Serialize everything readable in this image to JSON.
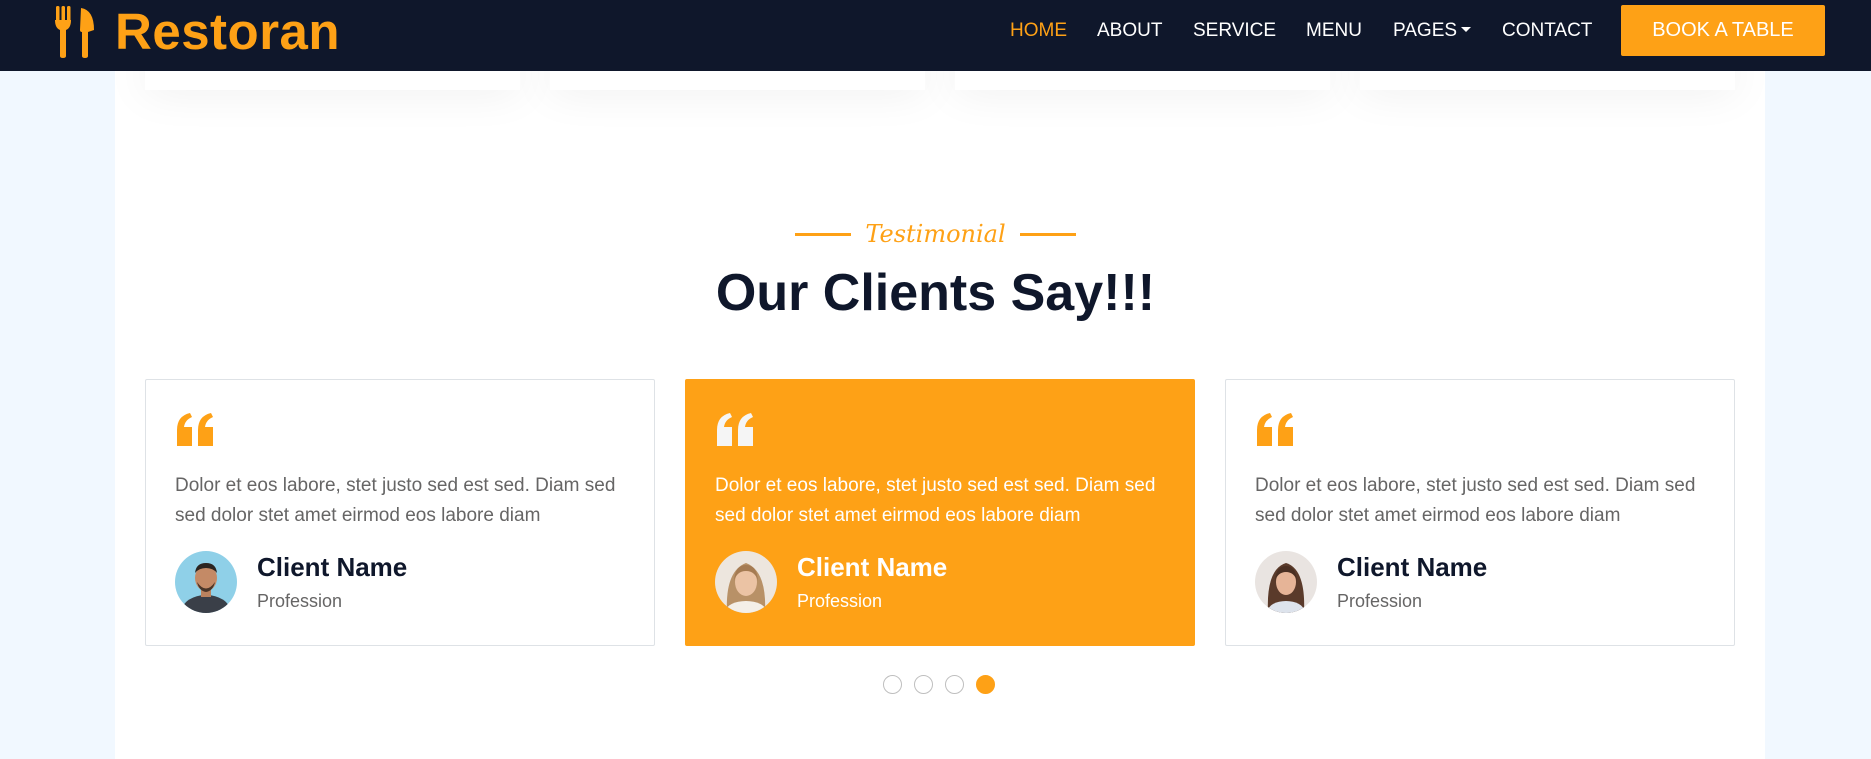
{
  "colors": {
    "primary": "#FEA116",
    "dark": "#0F172B",
    "text": "#666565",
    "page_bg": "#F1F8FF"
  },
  "navbar": {
    "brand": "Restoran",
    "brand_icon": "utensils-icon",
    "links": [
      {
        "label": "HOME",
        "active": true
      },
      {
        "label": "ABOUT",
        "active": false
      },
      {
        "label": "SERVICE",
        "active": false
      },
      {
        "label": "MENU",
        "active": false
      },
      {
        "label": "PAGES",
        "active": false,
        "dropdown": true
      },
      {
        "label": "CONTACT",
        "active": false
      }
    ],
    "cta": "BOOK A TABLE"
  },
  "section": {
    "subtitle": "Testimonial",
    "title": "Our Clients Say!!!"
  },
  "testimonials": [
    {
      "text": "Dolor et eos labore, stet justo sed est sed. Diam sed sed dolor stet amet eirmod eos labore diam",
      "name": "Client Name",
      "profession": "Profession",
      "avatar": "man-avatar",
      "featured": false
    },
    {
      "text": "Dolor et eos labore, stet justo sed est sed. Diam sed sed dolor stet amet eirmod eos labore diam",
      "name": "Client Name",
      "profession": "Profession",
      "avatar": "woman-avatar",
      "featured": true
    },
    {
      "text": "Dolor et eos labore, stet justo sed est sed. Diam sed sed dolor stet amet eirmod eos labore diam",
      "name": "Client Name",
      "profession": "Profession",
      "avatar": "woman-avatar",
      "featured": false
    }
  ],
  "carousel": {
    "dot_count": 4,
    "active_index": 3
  }
}
